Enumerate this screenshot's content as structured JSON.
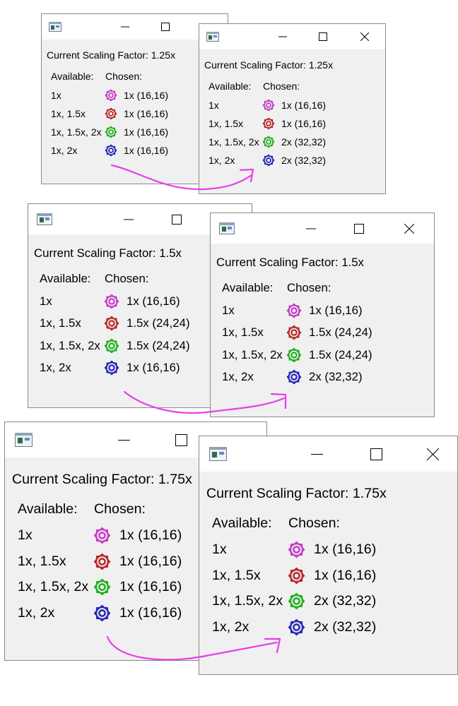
{
  "rows": [
    {
      "available": "1x",
      "color": "#c83cc8"
    },
    {
      "available": "1x, 1.5x",
      "color": "#b82828"
    },
    {
      "available": "1x, 1.5x, 2x",
      "color": "#22b022"
    },
    {
      "available": "1x, 2x",
      "color": "#2828b8"
    }
  ],
  "headers": {
    "available": "Available:",
    "chosen": "Chosen:"
  },
  "arrow_color": "#e83ee8",
  "groups": [
    {
      "before": {
        "scaling_label": "Current Scaling Factor: 1.25x",
        "chosen": [
          "1x (16,16)",
          "1x (16,16)",
          "1x (16,16)",
          "1x (16,16)"
        ]
      },
      "after": {
        "scaling_label": "Current Scaling Factor: 1.25x",
        "chosen": [
          "1x (16,16)",
          "1x (16,16)",
          "2x (32,32)",
          "2x (32,32)"
        ]
      }
    },
    {
      "before": {
        "scaling_label": "Current Scaling Factor: 1.5x",
        "chosen": [
          "1x (16,16)",
          "1.5x (24,24)",
          "1.5x (24,24)",
          "1x (16,16)"
        ]
      },
      "after": {
        "scaling_label": "Current Scaling Factor: 1.5x",
        "chosen": [
          "1x (16,16)",
          "1.5x (24,24)",
          "1.5x (24,24)",
          "2x (32,32)"
        ]
      }
    },
    {
      "before": {
        "scaling_label": "Current Scaling Factor: 1.75x",
        "chosen": [
          "1x (16,16)",
          "1x (16,16)",
          "1x (16,16)",
          "1x (16,16)"
        ]
      },
      "after": {
        "scaling_label": "Current Scaling Factor: 1.75x",
        "chosen": [
          "1x (16,16)",
          "1x (16,16)",
          "2x (32,32)",
          "2x (32,32)"
        ]
      }
    }
  ]
}
